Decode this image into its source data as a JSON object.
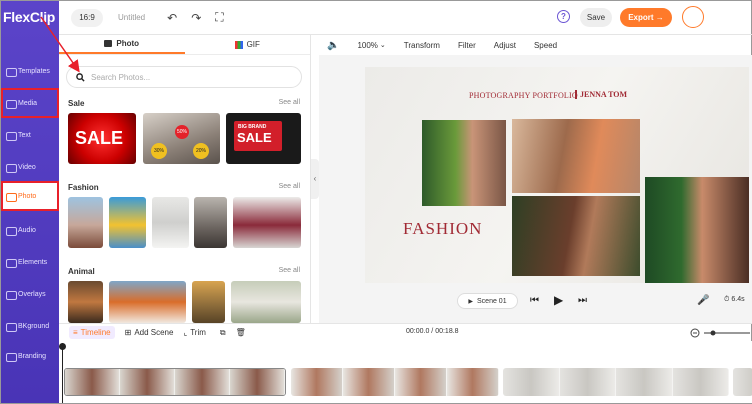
{
  "app": {
    "logo": "FlexClip"
  },
  "nav": {
    "items": [
      {
        "label": "Templates"
      },
      {
        "label": "Media"
      },
      {
        "label": "Text"
      },
      {
        "label": "Video"
      },
      {
        "label": "Photo"
      },
      {
        "label": "Audio"
      },
      {
        "label": "Elements"
      },
      {
        "label": "Overlays"
      },
      {
        "label": "BKground"
      },
      {
        "label": "Branding"
      }
    ]
  },
  "topbar": {
    "ratio": "16:9",
    "title": "Untitled",
    "save": "Save",
    "export": "Export →",
    "help": "?"
  },
  "panel": {
    "tabs": [
      {
        "label": "Photo"
      },
      {
        "label": "GIF"
      }
    ],
    "search_placeholder": "Search Photos...",
    "sections": [
      {
        "title": "Sale",
        "see_all": "See all"
      },
      {
        "title": "Fashion",
        "see_all": "See all"
      },
      {
        "title": "Animal",
        "see_all": "See all"
      }
    ],
    "sale_thumb_1": "SALE",
    "sale_thumb_2_a": "50%",
    "sale_thumb_2_b": "30%",
    "sale_thumb_2_c": "20%",
    "sale_thumb_3_a": "BIG BRAND",
    "sale_thumb_3_b": "SALE"
  },
  "stagebar": {
    "volume": "🔈",
    "zoom": "100%",
    "items": [
      {
        "label": "Transform"
      },
      {
        "label": "Filter"
      },
      {
        "label": "Adjust"
      },
      {
        "label": "Speed"
      }
    ]
  },
  "canvas": {
    "title": "PHOTOGRAPHY PORTFOLIO",
    "name": "JENNA TOM",
    "heading": "FASHION"
  },
  "player": {
    "scene": "Scene 01",
    "duration": "6.4s"
  },
  "timeline": {
    "tab": "Timeline",
    "add_scene": "Add Scene",
    "trim": "Trim",
    "time": "00:00.0 / 00:18.8"
  },
  "colors": {
    "nav": "#5b44c9",
    "accent": "#ff7a2a",
    "brand_red": "#a12a34",
    "highlight": "#e8202a"
  }
}
